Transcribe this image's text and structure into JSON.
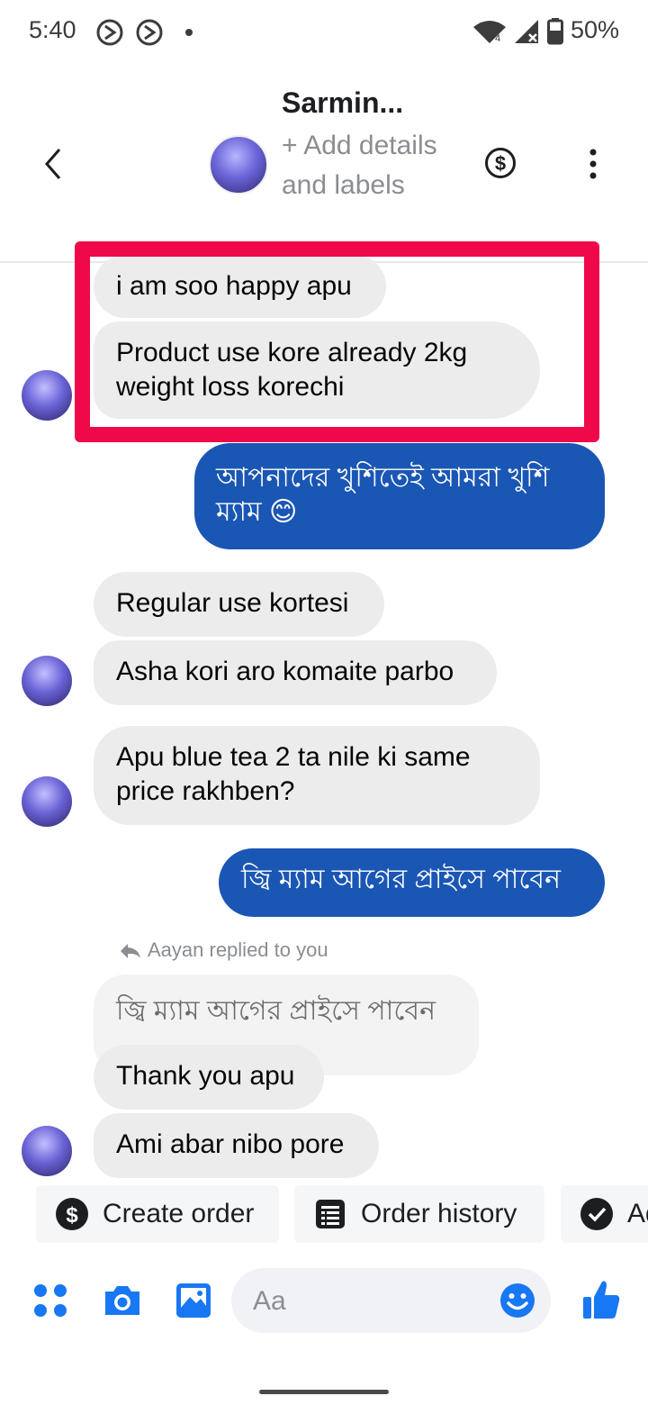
{
  "status_bar": {
    "time": "5:40",
    "battery": "50%"
  },
  "header": {
    "contact_name": "Sarmin...",
    "subtitle": "+ Add details and labels"
  },
  "messages": [
    {
      "side": "in",
      "text": "i am soo happy apu"
    },
    {
      "side": "in",
      "text": "Product use kore already 2kg weight loss korechi"
    },
    {
      "side": "out",
      "text": "আপনাদের খুশিতেই আমরা খুশি ম্যাম 😊"
    },
    {
      "side": "in",
      "text": "Regular use kortesi"
    },
    {
      "side": "in",
      "text": "Asha kori aro komaite parbo"
    },
    {
      "side": "in",
      "text": "Apu blue tea 2 ta nile ki same price rakhben?"
    },
    {
      "side": "out",
      "text": "জ্বি ম্যাম আগের প্রাইসে পাবেন"
    },
    {
      "side": "in",
      "text": "Thank you apu"
    },
    {
      "side": "in",
      "text": "Ami abar nibo pore"
    }
  ],
  "reply": {
    "label": "Aayan replied to you",
    "quoted_text": "জ্বি ম্যাম আগের প্রাইসে পাবেন"
  },
  "actions": [
    {
      "label": "Create order",
      "icon": "dollar-circle-icon"
    },
    {
      "label": "Order history",
      "icon": "receipt-icon"
    },
    {
      "label": "Ad",
      "icon": "check-circle-icon"
    }
  ],
  "composer": {
    "placeholder": "Aa",
    "icons": [
      "apps-icon",
      "camera-icon",
      "gallery-icon",
      "emoji-icon",
      "thumbs-up-icon"
    ]
  },
  "colors": {
    "accent": "#1a56b4",
    "icon_blue": "#1877f2",
    "highlight": "#f0094a",
    "incoming_bubble": "#ececec"
  }
}
